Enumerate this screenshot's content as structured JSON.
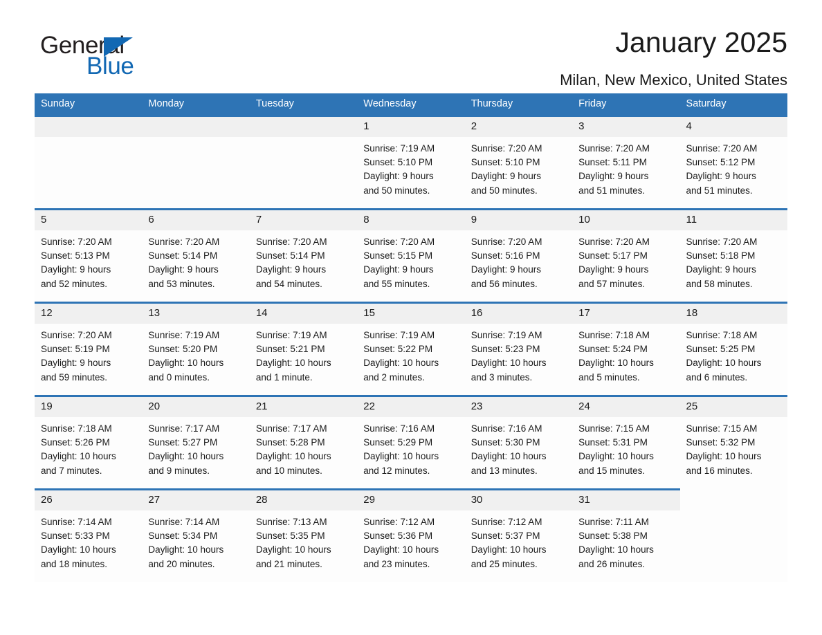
{
  "brand": {
    "name_part1": "General",
    "name_part2": "Blue",
    "triangle_color": "#1268b3",
    "text_color": "#231f20"
  },
  "header": {
    "title": "January 2025",
    "subtitle": "Milan, New Mexico, United States"
  },
  "theme": {
    "header_bg": "#2e74b5",
    "header_text": "#ffffff",
    "daynum_bg": "#f0f0f0",
    "cell_bg": "#fdfdfd",
    "rule_color": "#2e74b5"
  },
  "weekday_headers": [
    "Sunday",
    "Monday",
    "Tuesday",
    "Wednesday",
    "Thursday",
    "Friday",
    "Saturday"
  ],
  "labels": {
    "sunrise_prefix": "Sunrise: ",
    "sunset_prefix": "Sunset: ",
    "daylight_prefix": "Daylight: "
  },
  "weeks": [
    [
      {
        "blank": true
      },
      {
        "blank": true
      },
      {
        "blank": true
      },
      {
        "day": "1",
        "line1": "Sunrise: 7:19 AM",
        "line2": "Sunset: 5:10 PM",
        "line3": "Daylight: 9 hours",
        "line4": "and 50 minutes."
      },
      {
        "day": "2",
        "line1": "Sunrise: 7:20 AM",
        "line2": "Sunset: 5:10 PM",
        "line3": "Daylight: 9 hours",
        "line4": "and 50 minutes."
      },
      {
        "day": "3",
        "line1": "Sunrise: 7:20 AM",
        "line2": "Sunset: 5:11 PM",
        "line3": "Daylight: 9 hours",
        "line4": "and 51 minutes."
      },
      {
        "day": "4",
        "line1": "Sunrise: 7:20 AM",
        "line2": "Sunset: 5:12 PM",
        "line3": "Daylight: 9 hours",
        "line4": "and 51 minutes."
      }
    ],
    [
      {
        "day": "5",
        "line1": "Sunrise: 7:20 AM",
        "line2": "Sunset: 5:13 PM",
        "line3": "Daylight: 9 hours",
        "line4": "and 52 minutes."
      },
      {
        "day": "6",
        "line1": "Sunrise: 7:20 AM",
        "line2": "Sunset: 5:14 PM",
        "line3": "Daylight: 9 hours",
        "line4": "and 53 minutes."
      },
      {
        "day": "7",
        "line1": "Sunrise: 7:20 AM",
        "line2": "Sunset: 5:14 PM",
        "line3": "Daylight: 9 hours",
        "line4": "and 54 minutes."
      },
      {
        "day": "8",
        "line1": "Sunrise: 7:20 AM",
        "line2": "Sunset: 5:15 PM",
        "line3": "Daylight: 9 hours",
        "line4": "and 55 minutes."
      },
      {
        "day": "9",
        "line1": "Sunrise: 7:20 AM",
        "line2": "Sunset: 5:16 PM",
        "line3": "Daylight: 9 hours",
        "line4": "and 56 minutes."
      },
      {
        "day": "10",
        "line1": "Sunrise: 7:20 AM",
        "line2": "Sunset: 5:17 PM",
        "line3": "Daylight: 9 hours",
        "line4": "and 57 minutes."
      },
      {
        "day": "11",
        "line1": "Sunrise: 7:20 AM",
        "line2": "Sunset: 5:18 PM",
        "line3": "Daylight: 9 hours",
        "line4": "and 58 minutes."
      }
    ],
    [
      {
        "day": "12",
        "line1": "Sunrise: 7:20 AM",
        "line2": "Sunset: 5:19 PM",
        "line3": "Daylight: 9 hours",
        "line4": "and 59 minutes."
      },
      {
        "day": "13",
        "line1": "Sunrise: 7:19 AM",
        "line2": "Sunset: 5:20 PM",
        "line3": "Daylight: 10 hours",
        "line4": "and 0 minutes."
      },
      {
        "day": "14",
        "line1": "Sunrise: 7:19 AM",
        "line2": "Sunset: 5:21 PM",
        "line3": "Daylight: 10 hours",
        "line4": "and 1 minute."
      },
      {
        "day": "15",
        "line1": "Sunrise: 7:19 AM",
        "line2": "Sunset: 5:22 PM",
        "line3": "Daylight: 10 hours",
        "line4": "and 2 minutes."
      },
      {
        "day": "16",
        "line1": "Sunrise: 7:19 AM",
        "line2": "Sunset: 5:23 PM",
        "line3": "Daylight: 10 hours",
        "line4": "and 3 minutes."
      },
      {
        "day": "17",
        "line1": "Sunrise: 7:18 AM",
        "line2": "Sunset: 5:24 PM",
        "line3": "Daylight: 10 hours",
        "line4": "and 5 minutes."
      },
      {
        "day": "18",
        "line1": "Sunrise: 7:18 AM",
        "line2": "Sunset: 5:25 PM",
        "line3": "Daylight: 10 hours",
        "line4": "and 6 minutes."
      }
    ],
    [
      {
        "day": "19",
        "line1": "Sunrise: 7:18 AM",
        "line2": "Sunset: 5:26 PM",
        "line3": "Daylight: 10 hours",
        "line4": "and 7 minutes."
      },
      {
        "day": "20",
        "line1": "Sunrise: 7:17 AM",
        "line2": "Sunset: 5:27 PM",
        "line3": "Daylight: 10 hours",
        "line4": "and 9 minutes."
      },
      {
        "day": "21",
        "line1": "Sunrise: 7:17 AM",
        "line2": "Sunset: 5:28 PM",
        "line3": "Daylight: 10 hours",
        "line4": "and 10 minutes."
      },
      {
        "day": "22",
        "line1": "Sunrise: 7:16 AM",
        "line2": "Sunset: 5:29 PM",
        "line3": "Daylight: 10 hours",
        "line4": "and 12 minutes."
      },
      {
        "day": "23",
        "line1": "Sunrise: 7:16 AM",
        "line2": "Sunset: 5:30 PM",
        "line3": "Daylight: 10 hours",
        "line4": "and 13 minutes."
      },
      {
        "day": "24",
        "line1": "Sunrise: 7:15 AM",
        "line2": "Sunset: 5:31 PM",
        "line3": "Daylight: 10 hours",
        "line4": "and 15 minutes."
      },
      {
        "day": "25",
        "line1": "Sunrise: 7:15 AM",
        "line2": "Sunset: 5:32 PM",
        "line3": "Daylight: 10 hours",
        "line4": "and 16 minutes."
      }
    ],
    [
      {
        "day": "26",
        "line1": "Sunrise: 7:14 AM",
        "line2": "Sunset: 5:33 PM",
        "line3": "Daylight: 10 hours",
        "line4": "and 18 minutes."
      },
      {
        "day": "27",
        "line1": "Sunrise: 7:14 AM",
        "line2": "Sunset: 5:34 PM",
        "line3": "Daylight: 10 hours",
        "line4": "and 20 minutes."
      },
      {
        "day": "28",
        "line1": "Sunrise: 7:13 AM",
        "line2": "Sunset: 5:35 PM",
        "line3": "Daylight: 10 hours",
        "line4": "and 21 minutes."
      },
      {
        "day": "29",
        "line1": "Sunrise: 7:12 AM",
        "line2": "Sunset: 5:36 PM",
        "line3": "Daylight: 10 hours",
        "line4": "and 23 minutes."
      },
      {
        "day": "30",
        "line1": "Sunrise: 7:12 AM",
        "line2": "Sunset: 5:37 PM",
        "line3": "Daylight: 10 hours",
        "line4": "and 25 minutes."
      },
      {
        "day": "31",
        "line1": "Sunrise: 7:11 AM",
        "line2": "Sunset: 5:38 PM",
        "line3": "Daylight: 10 hours",
        "line4": "and 26 minutes."
      },
      {
        "blank": true
      }
    ]
  ]
}
